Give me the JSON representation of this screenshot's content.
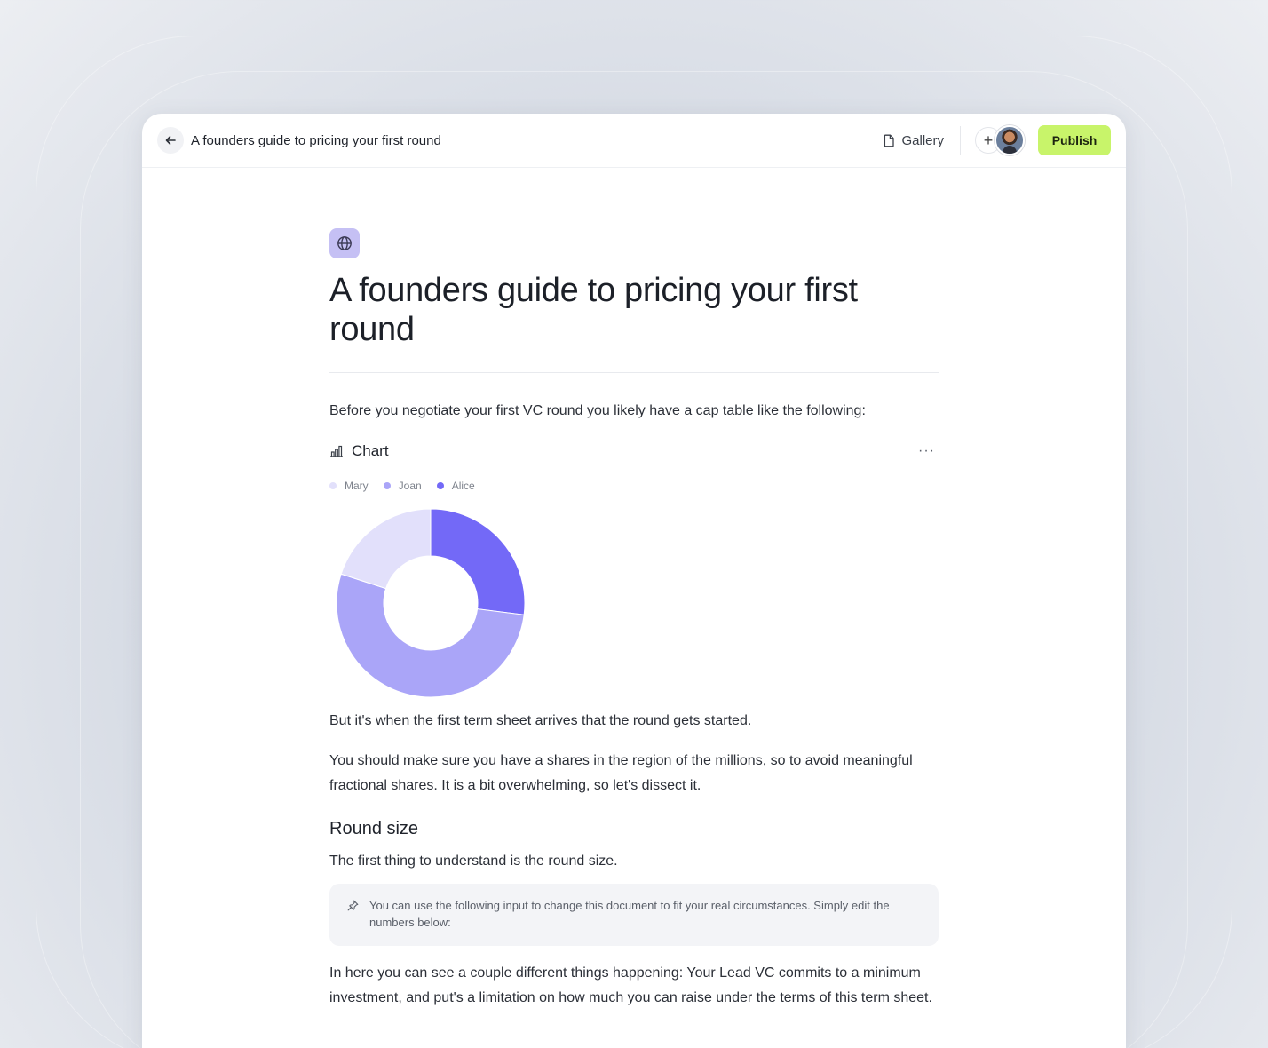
{
  "topbar": {
    "doc_title": "A founders guide to pricing your first round",
    "gallery_label": "Gallery",
    "add_collaborator": "+",
    "publish_label": "Publish"
  },
  "page": {
    "title": "A founders guide to pricing your first round",
    "intro": "Before you negotiate your first VC round you likely have a cap table like the following:",
    "chart_block_title": "Chart",
    "more_menu": "···",
    "after_chart": "But it's when the first term sheet arrives that the round gets started.",
    "shares_paragraph": "You should make sure you have a shares in the region of the millions, so to avoid meaningful fractional shares. It is a bit overwhelming, so let's dissect it.",
    "section_heading": "Round size",
    "section_intro": "The first thing to understand is the round size.",
    "callout": "You can use the following input to change this document to fit your real circumstances. Simply edit the numbers below:",
    "closing": "In here you can see a couple different things happening: Your Lead VC commits to a minimum investment, and put's a limitation on how much you can raise under the terms of this term sheet."
  },
  "chart_data": {
    "type": "pie",
    "donut": true,
    "legend_position": "top-left",
    "categories": [
      "Mary",
      "Joan",
      "Alice"
    ],
    "values": [
      20,
      53,
      27
    ],
    "colors": [
      "#e2e0fb",
      "#aaa5f8",
      "#7369f7"
    ]
  },
  "colors": {
    "accent_publish": "#c8f46a",
    "page_icon_bg": "#c5c0f4"
  },
  "icons": {
    "back": "arrow-left-icon",
    "gallery": "document-icon",
    "page": "globe-icon",
    "chart": "bar-chart-icon",
    "callout": "pin-icon"
  }
}
